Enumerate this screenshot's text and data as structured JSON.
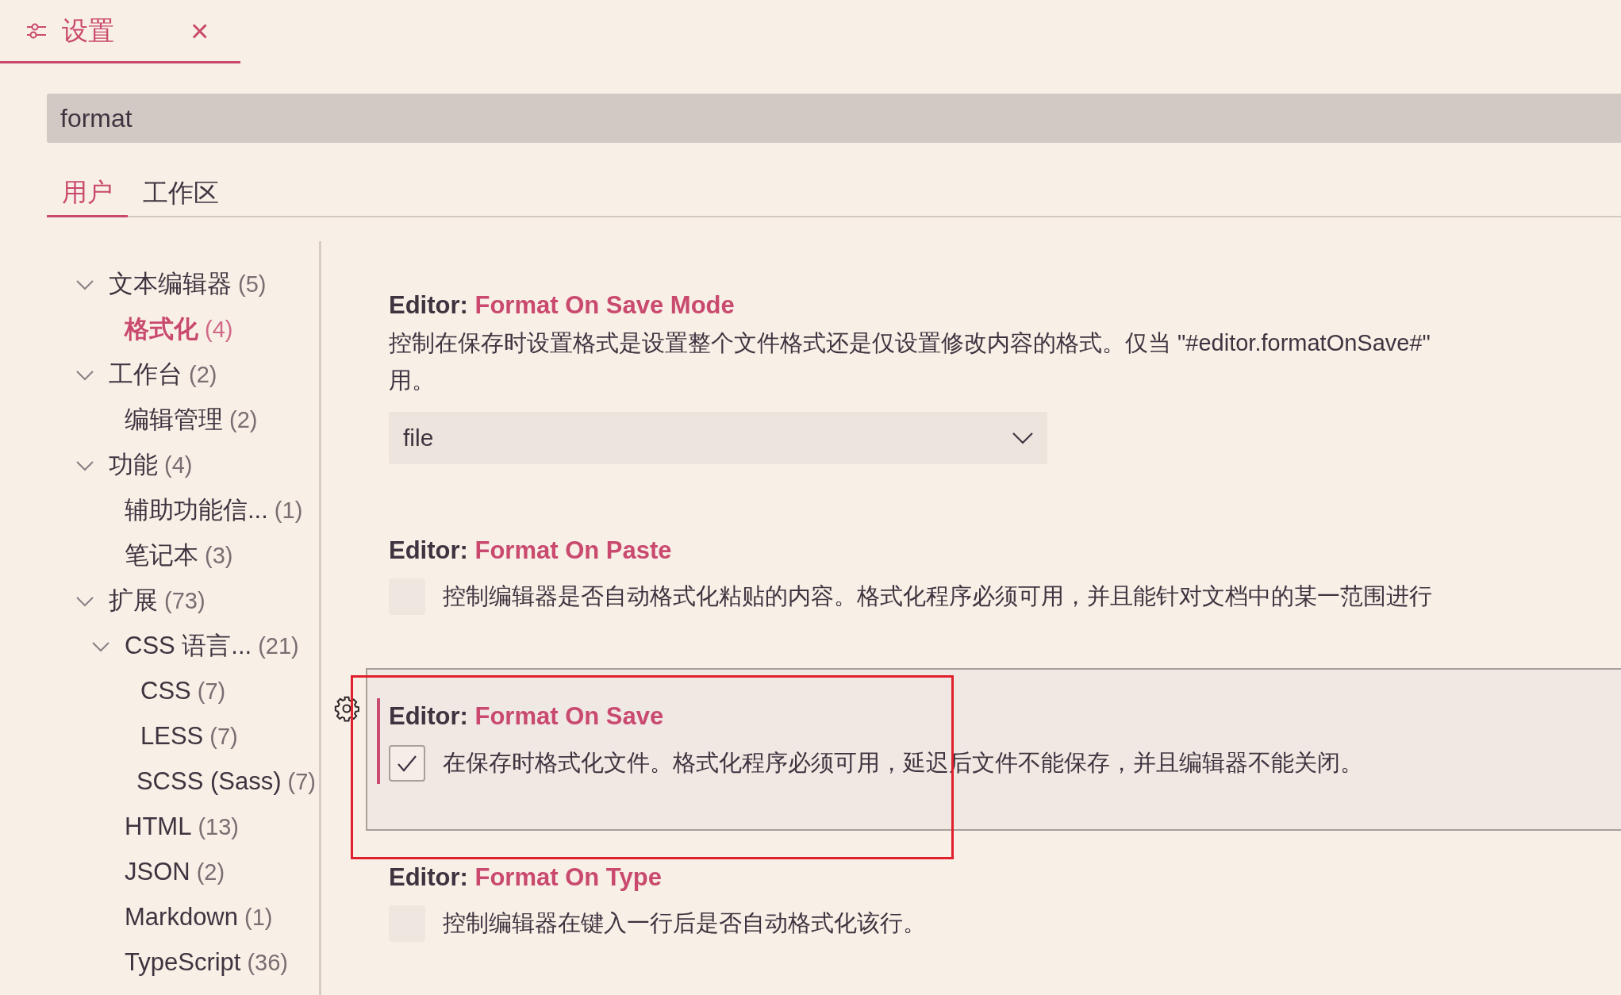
{
  "editor_tab": {
    "title": "设置",
    "close": "×"
  },
  "search": {
    "value": "format"
  },
  "scope_tabs": [
    {
      "label": "用户",
      "selected": true
    },
    {
      "label": "工作区",
      "selected": false
    }
  ],
  "tree": [
    {
      "label": "文本编辑器",
      "count": "(5)",
      "expanded": true,
      "selected": false,
      "children": [
        {
          "label": "格式化",
          "count": "(4)",
          "selected": true
        }
      ]
    },
    {
      "label": "工作台",
      "count": "(2)",
      "expanded": true,
      "selected": false,
      "children": [
        {
          "label": "编辑管理",
          "count": "(2)",
          "selected": false
        }
      ]
    },
    {
      "label": "功能",
      "count": "(4)",
      "expanded": true,
      "selected": false,
      "children": [
        {
          "label": "辅助功能信...",
          "count": "(1)",
          "selected": false
        },
        {
          "label": "笔记本",
          "count": "(3)",
          "selected": false
        }
      ]
    },
    {
      "label": "扩展",
      "count": "(73)",
      "expanded": true,
      "selected": false,
      "children": [
        {
          "label": "CSS 语言...",
          "count": "(21)",
          "expanded": true,
          "selected": false,
          "children": [
            {
              "label": "CSS",
              "count": "(7)",
              "selected": false
            },
            {
              "label": "LESS",
              "count": "(7)",
              "selected": false
            },
            {
              "label": "SCSS (Sass)",
              "count": "(7)",
              "selected": false
            }
          ]
        },
        {
          "label": "HTML",
          "count": "(13)",
          "selected": false
        },
        {
          "label": "JSON",
          "count": "(2)",
          "selected": false
        },
        {
          "label": "Markdown",
          "count": "(1)",
          "selected": false
        },
        {
          "label": "TypeScript",
          "count": "(36)",
          "selected": false
        }
      ]
    }
  ],
  "settings": [
    {
      "kind": "select",
      "category": "Editor:",
      "name": "Format On Save Mode",
      "description": [
        "控制在保存时设置格式是设置整个文件格式还是仅设置修改内容的格式。仅当 \"#editor.formatOnSave#\"",
        "用。"
      ],
      "value": "file",
      "focused": false,
      "annotated": false
    },
    {
      "kind": "checkbox",
      "category": "Editor:",
      "name": "Format On Paste",
      "description": [
        "控制编辑器是否自动格式化粘贴的内容。格式化程序必须可用，并且能针对文档中的某一范围进行"
      ],
      "checked": false,
      "focused": false,
      "annotated": false
    },
    {
      "kind": "checkbox",
      "category": "Editor:",
      "name": "Format On Save",
      "description": [
        "在保存时格式化文件。格式化程序必须可用，延迟后文件不能保存，并且编辑器不能关闭。"
      ],
      "checked": true,
      "focused": true,
      "annotated": true
    },
    {
      "kind": "checkbox",
      "category": "Editor:",
      "name": "Format On Type",
      "description": [
        "控制编辑器在键入一行后是否自动格式化该行。"
      ],
      "checked": false,
      "focused": false,
      "annotated": false
    }
  ]
}
